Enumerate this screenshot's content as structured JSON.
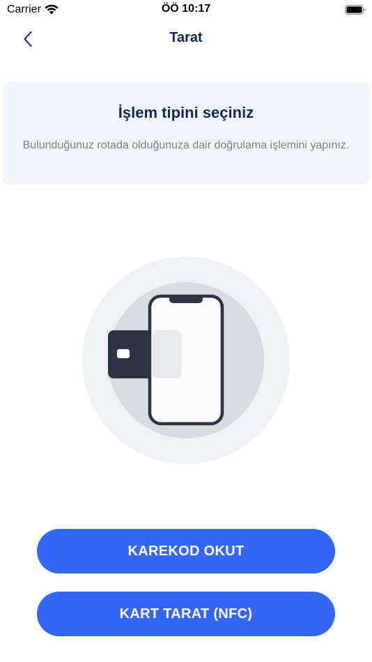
{
  "status_bar": {
    "carrier": "Carrier",
    "time": "ÖÖ 10:17"
  },
  "nav": {
    "title": "Tarat",
    "back_icon": "chevron-left-icon"
  },
  "info_card": {
    "title": "İşlem tipini seçiniz",
    "description": "Bulunduğunuz rotada olduğunuza dair doğrulama işlemini yapınız."
  },
  "illustration": {
    "icon": "nfc-card-phone-icon"
  },
  "buttons": {
    "qr_label": "KAREKOD OKUT",
    "nfc_label": "KART TARAT (NFC)"
  },
  "colors": {
    "primary": "#3466f7",
    "title": "#0e2a50",
    "card_bg": "#f1f5fc",
    "muted_text": "#7f7f85"
  }
}
